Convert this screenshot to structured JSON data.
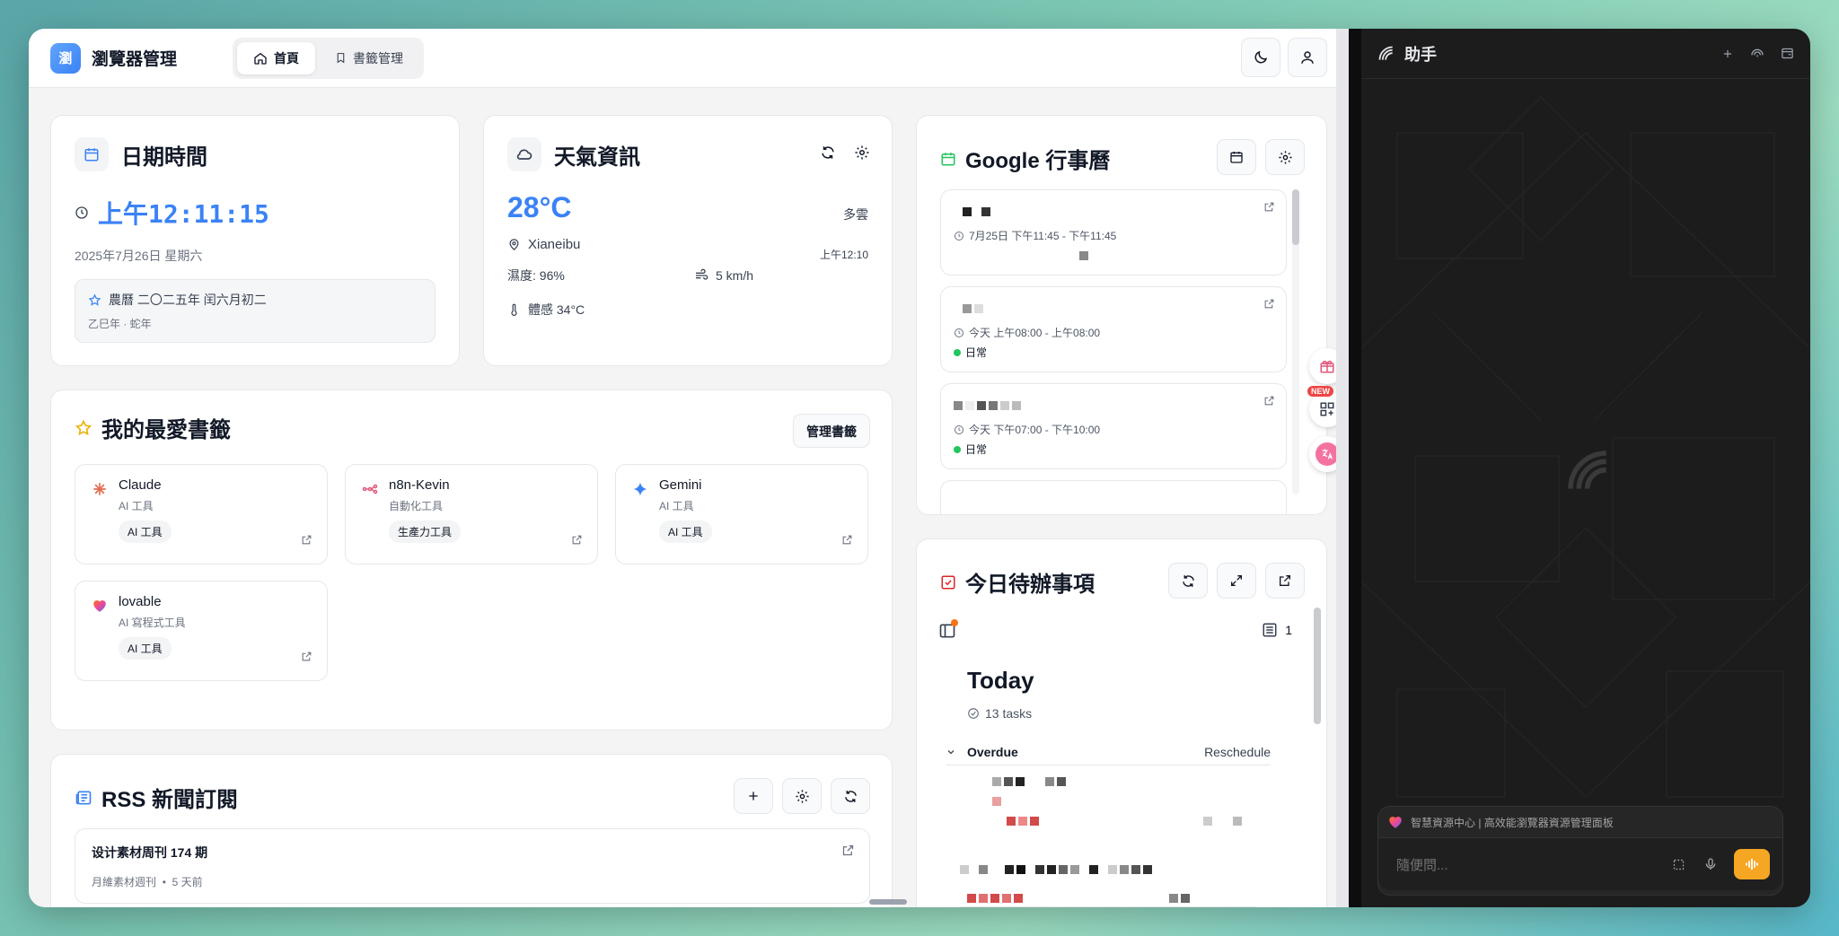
{
  "app": {
    "logo_text": "瀏",
    "title": "瀏覽器管理",
    "nav": [
      {
        "label": "首頁"
      },
      {
        "label": "書籤管理"
      }
    ]
  },
  "datetime": {
    "title": "日期時間",
    "time": "上午12:11:15",
    "date": "2025年7月26日 星期六",
    "lunar": "農曆 二〇二五年 闰六月初二",
    "ganzhi": "乙巳年 · 蛇年"
  },
  "weather": {
    "title": "天氣資訊",
    "temp": "28°C",
    "condition": "多雲",
    "location": "Xianeibu",
    "updated": "上午12:10",
    "humidity": "濕度: 96%",
    "wind": "5 km/h",
    "feels": "體感 34°C"
  },
  "bookmarks": {
    "title": "我的最愛書籤",
    "manage_label": "管理書籤",
    "items": [
      {
        "name": "Claude",
        "category": "AI 工具",
        "tag": "AI 工具"
      },
      {
        "name": "n8n-Kevin",
        "category": "自動化工具",
        "tag": "生產力工具"
      },
      {
        "name": "Gemini",
        "category": "AI 工具",
        "tag": "AI 工具"
      },
      {
        "name": "lovable",
        "category": "AI 寫程式工具",
        "tag": "AI 工具"
      }
    ]
  },
  "rss": {
    "title": "RSS 新聞訂閱",
    "items": [
      {
        "title": "设计素材周刊 174 期",
        "source": "月維素材週刊",
        "age": "5 天前"
      }
    ]
  },
  "calendar": {
    "title": "Google 行事曆",
    "events": [
      {
        "time": "7月25日 下午11:45 - 下午11:45",
        "tag": ""
      },
      {
        "time": "今天 上午08:00 - 上午08:00",
        "tag": "日常"
      },
      {
        "time": "今天 下午07:00 - 下午10:00",
        "tag": "日常"
      }
    ]
  },
  "todo": {
    "title": "今日待辦事項",
    "count": "1",
    "heading": "Today",
    "tasks": "13 tasks",
    "overdue": "Overdue",
    "reschedule": "Reschedule"
  },
  "side": {
    "new_badge": "NEW"
  },
  "assistant": {
    "title": "助手",
    "info": "智慧資源中心 | 高效能瀏覽器資源管理面板",
    "placeholder": "隨便問..."
  },
  "colors": {
    "accent": "#3b82f6",
    "todo_red": "#dc2626",
    "calendar_green": "#22c55e",
    "tag_dot": "#22c55e",
    "voice_btn": "#f5a623"
  }
}
